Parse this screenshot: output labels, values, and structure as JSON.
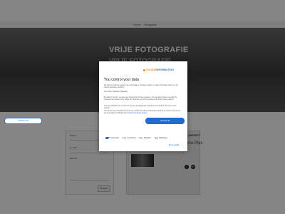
{
  "site": {
    "breadcrumb": [
      "Home",
      "Fotografie"
    ],
    "hero_title": "VRIJE FOTOGRAFIE",
    "hero_sub": "VRIJE FOTOGRAFIE",
    "form": {
      "name_label": "Naam *",
      "email_label": "E-mail *",
      "message_label": "Bericht *",
      "submit_label": "Verstuur"
    },
    "contact": {
      "title": "CONTACT",
      "name": "Ilona Plas"
    },
    "social": [
      "f",
      "in"
    ]
  },
  "consent": {
    "logo_cookie": "COOKIE",
    "logo_info": "INFORMATION",
    "title": "You control your data",
    "paragraphs": [
      "We and our business partners use technologies, including cookies, to collect information about you for various purposes, including:",
      "Functional, Statistical, Marketing",
      "By clicking 'Accept', you give your consent for all these purposes. You can also choose to specify the purposes you consent to by ticking the checkbox next to the purpose and clicking 'Save settings'.",
      "You may withdraw your consent at any time by clicking the small icon at the bottom left corner of the website.",
      "You can find out more about how we use cookies and other technologies and how we collect and process personal data by clicking the link."
    ],
    "more_link": "Read more about cookies",
    "decline_label": "Decline all",
    "accept_label": "Accept all",
    "toggles": [
      {
        "label": "Necessary",
        "on": true
      },
      {
        "label": "Functional",
        "on": false
      },
      {
        "label": "Statistics",
        "on": false
      },
      {
        "label": "Marketing",
        "on": false
      }
    ],
    "show_details": "Show details",
    "accent": "#1f6bd6",
    "logo_orange": "#e58a1f"
  }
}
